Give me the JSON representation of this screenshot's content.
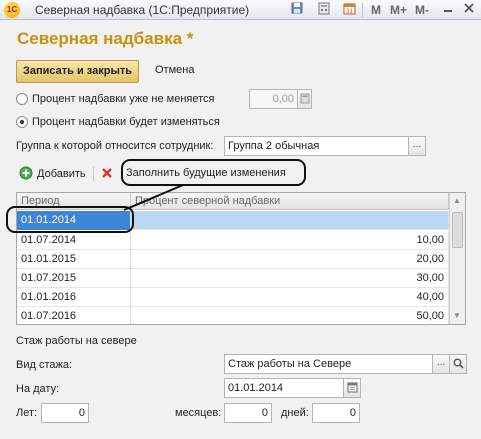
{
  "window": {
    "app_icon_text": "1C",
    "title": "Северная надбавка (1С:Предприятие)",
    "toolbar_icons": [
      "save-icon",
      "calc-icon",
      "calendar-icon"
    ],
    "m_labels": [
      "M",
      "M+",
      "M-"
    ],
    "controls": [
      "minimize-icon",
      "maximize-icon",
      "close-icon"
    ]
  },
  "form": {
    "title": "Северная надбавка *",
    "save_close_label": "Записать и закрыть",
    "cancel_label": "Отмена",
    "radio_fixed_label": "Процент надбавки уже не меняется",
    "radio_fixed_value": "0,00",
    "radio_changing_label": "Процент надбавки будет изменяться",
    "group_label": "Группа к которой относится сотрудник:",
    "group_value": "Группа 2 обычная",
    "add_label": "Добавить",
    "fill_future_label": "Заполнить будущие изменения"
  },
  "table": {
    "columns": [
      "Период",
      "Процент северной надбавки"
    ],
    "rows": [
      {
        "period": "01.01.2014",
        "percent": ""
      },
      {
        "period": "01.07.2014",
        "percent": "10,00"
      },
      {
        "period": "01.01.2015",
        "percent": "20,00"
      },
      {
        "period": "01.07.2015",
        "percent": "30,00"
      },
      {
        "period": "01.01.2016",
        "percent": "40,00"
      },
      {
        "period": "01.07.2016",
        "percent": "50,00"
      }
    ]
  },
  "experience": {
    "section_label": "Стаж работы на севере",
    "type_label": "Вид стажа:",
    "type_value": "Стаж работы на Севере",
    "date_label": "На дату:",
    "date_value": "01.01.2014",
    "years_label": "Лет:",
    "years_value": "0",
    "months_label": "месяцев:",
    "months_value": "0",
    "days_label": "дней:",
    "days_value": "0"
  },
  "colors": {
    "title_accent": "#c8920e",
    "selected_cell": "#3f85d6",
    "selected_row": "#bcd9f3"
  }
}
